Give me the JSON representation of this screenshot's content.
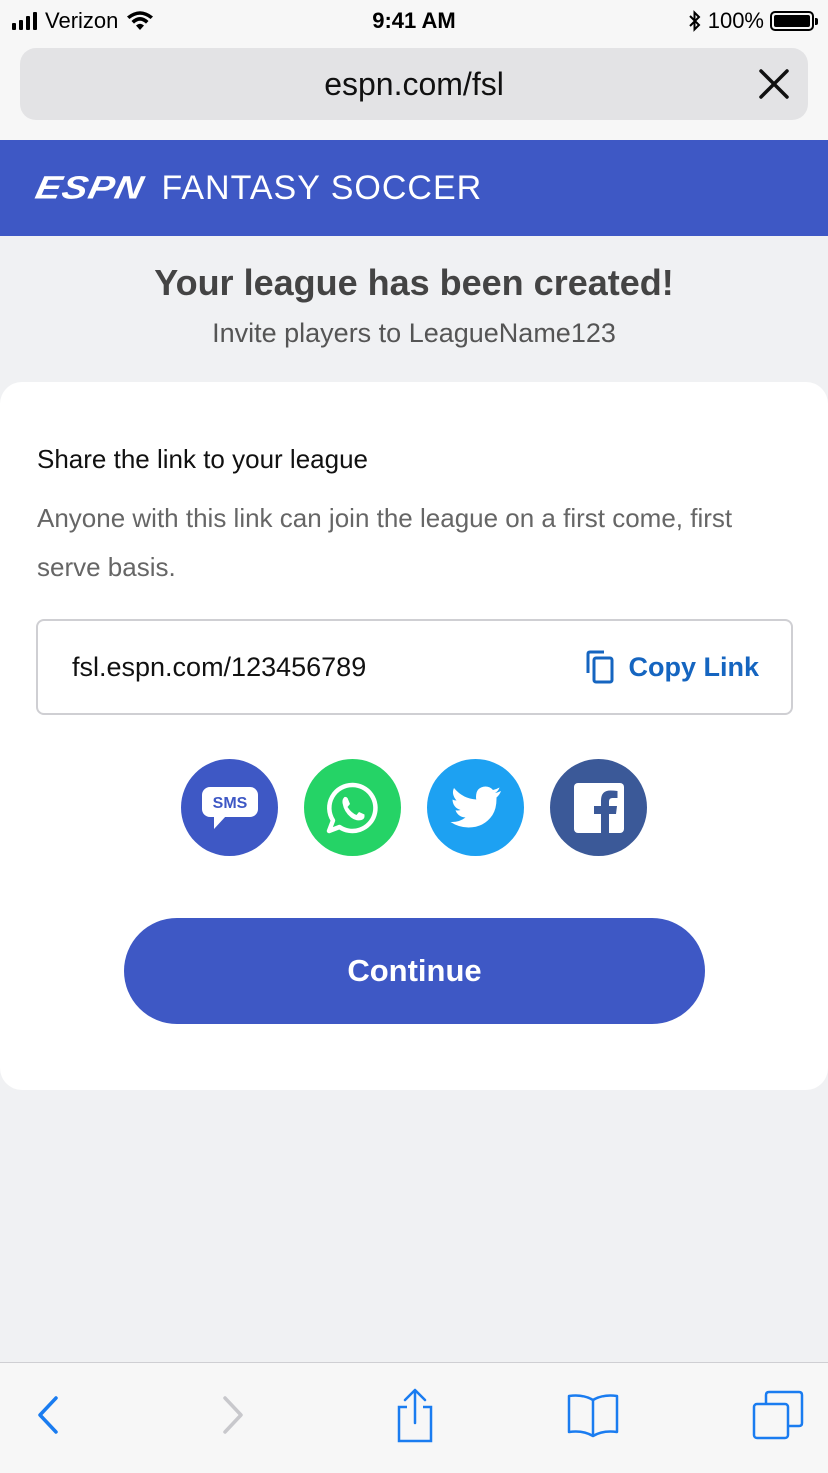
{
  "status_bar": {
    "carrier": "Verizon",
    "time": "9:41 AM",
    "battery": "100%",
    "battery_level": 1.0
  },
  "browser": {
    "url": "espn.com/fsl"
  },
  "header": {
    "logo": "ESPN",
    "title": "FANTASY SOCCER",
    "brand_color": "#3e58c5"
  },
  "main": {
    "title": "Your league has been created!",
    "subtitle": "Invite players to LeagueName123"
  },
  "share": {
    "heading": "Share the link to your league",
    "description": "Anyone with this link can join the league on a first come, first serve basis.",
    "link": "fsl.espn.com/123456789",
    "copy_label": "Copy Link",
    "buttons": [
      {
        "name": "sms",
        "label": "SMS",
        "color": "#3e58c5",
        "icon": "sms-icon"
      },
      {
        "name": "whatsapp",
        "color": "#25d366",
        "icon": "whatsapp-icon"
      },
      {
        "name": "twitter",
        "color": "#1da1f2",
        "icon": "twitter-icon"
      },
      {
        "name": "facebook",
        "color": "#3b5998",
        "icon": "facebook-icon"
      }
    ]
  },
  "continue_label": "Continue",
  "toolbar": {
    "icons": [
      "back-icon",
      "forward-icon",
      "share-icon",
      "bookmarks-icon",
      "tabs-icon"
    ],
    "accent": "#1a7cf0"
  }
}
